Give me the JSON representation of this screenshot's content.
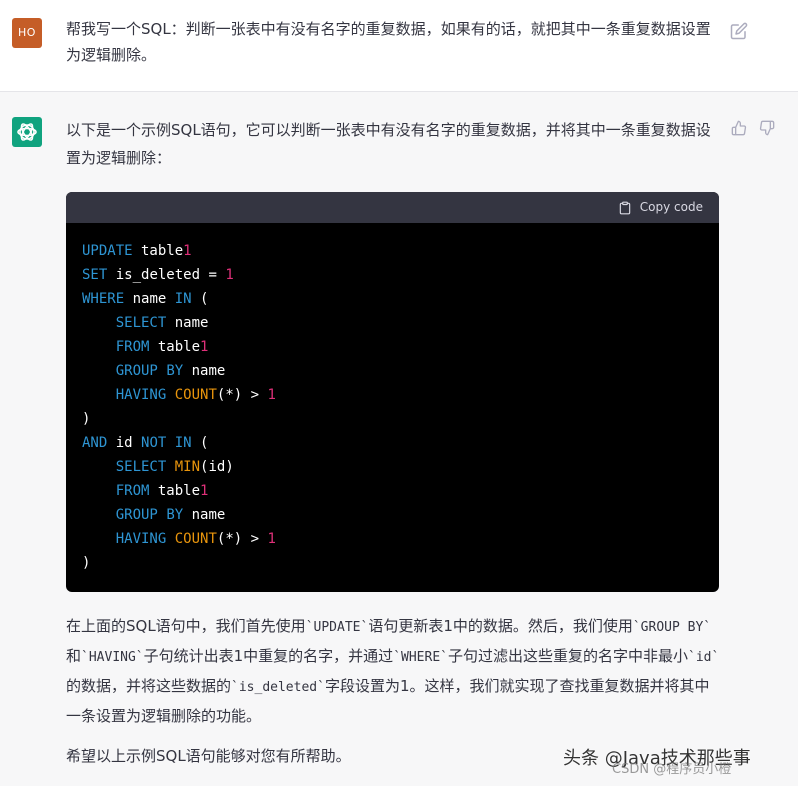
{
  "user_message": {
    "avatar_initials": "HO",
    "text": "帮我写一个SQL：判断一张表中有没有名字的重复数据，如果有的话，就把其中一条重复数据设置为逻辑删除。"
  },
  "assistant_message": {
    "intro": "以下是一个示例SQL语句，它可以判断一张表中有没有名字的重复数据，并将其中一条重复数据设置为逻辑删除：",
    "copy_label": "Copy code",
    "code_lines": [
      "UPDATE table1",
      "SET is_deleted = 1",
      "WHERE name IN (",
      "    SELECT name",
      "    FROM table1",
      "    GROUP BY name",
      "    HAVING COUNT(*) > 1",
      ")",
      "AND id NOT IN (",
      "    SELECT MIN(id)",
      "    FROM table1",
      "    GROUP BY name",
      "    HAVING COUNT(*) > 1",
      ")"
    ],
    "explanation": {
      "p1": "在上面的SQL语句中，我们首先使用",
      "c1": "`UPDATE`",
      "p2": "语句更新表1中的数据。然后，我们使用",
      "c2": "`GROUP BY`",
      "p3": "和",
      "c3": "`HAVING`",
      "p4": "子句统计出表1中重复的名字，并通过",
      "c4": "`WHERE`",
      "p5": "子句过滤出这些重复的名字中非最小",
      "c5": "`id`",
      "p6": "的数据，并将这些数据的",
      "c6": "`is_deleted`",
      "p7": "字段设置为1。这样，我们就实现了查找重复数据并将其中一条设置为逻辑删除的功能。"
    },
    "closing": "希望以上示例SQL语句能够对您有所帮助。"
  },
  "watermark": {
    "main": "头条 @Java技术那些事",
    "csdn": "CSDN @程序员小橙"
  },
  "colors": {
    "user_avatar": "#c55d27",
    "bot_avatar": "#10a37f",
    "code_bg": "#000000",
    "code_header": "#343541",
    "keyword": "#2e95d3",
    "function": "#e9950c",
    "number": "#df3079"
  },
  "icons": [
    "edit-icon",
    "openai-logo-icon",
    "thumbs-up-icon",
    "thumbs-down-icon",
    "clipboard-icon"
  ]
}
